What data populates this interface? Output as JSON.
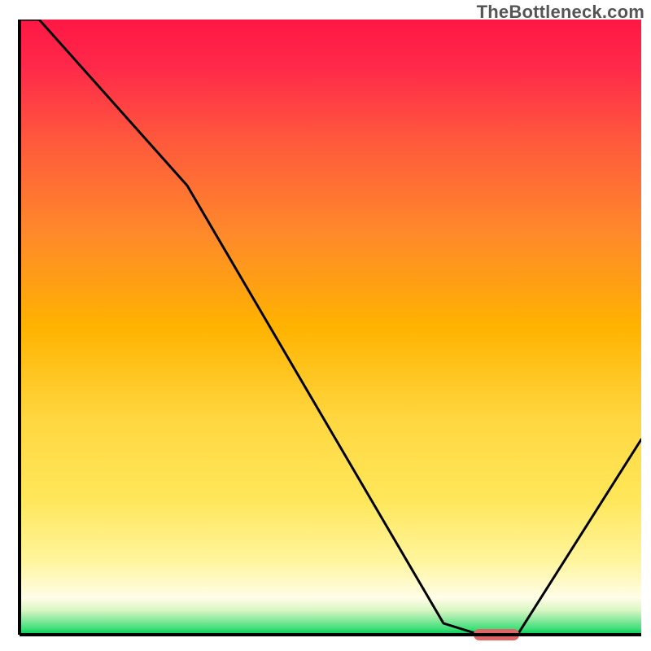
{
  "watermark": "TheBottleneck.com",
  "chart_data": {
    "type": "line",
    "title": "",
    "xlabel": "",
    "ylabel": "",
    "xlim": [
      0,
      100
    ],
    "ylim": [
      0,
      100
    ],
    "grid": false,
    "legend": false,
    "x": [
      0,
      3,
      27,
      68,
      74,
      80,
      100
    ],
    "values": [
      100,
      100,
      73,
      2,
      0,
      0,
      32
    ],
    "marker": {
      "x_range": [
        73,
        80
      ],
      "y": 0,
      "color": "#e06666",
      "shape": "pill"
    },
    "background_gradient": {
      "top_color": "#ff1744",
      "mid_colors": [
        "#ff6a3c",
        "#ffb300",
        "#ffe24d",
        "#fff59d",
        "#fffde7"
      ],
      "bottom_color": "#00e676",
      "bottom_edge_color": "#00c853"
    },
    "axes_color": "#000000",
    "curve_color": "#000000",
    "note": "Axis values are normalized 0-100; no tick labels or numeric annotations are visible in the source image. Curve y-values estimated from gridless pixel positions."
  }
}
